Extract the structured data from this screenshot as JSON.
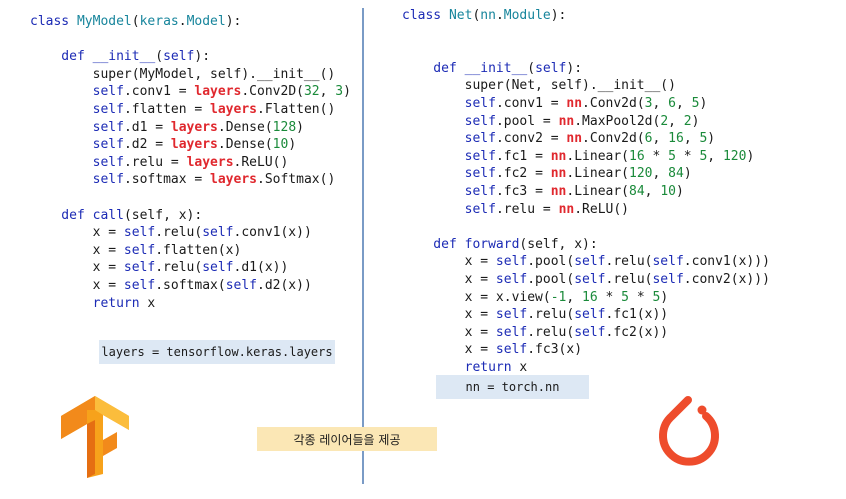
{
  "tensorflow": {
    "class_line": [
      {
        "t": "class ",
        "c": "kw"
      },
      {
        "t": "MyModel",
        "c": "cls"
      },
      {
        "t": "(",
        "c": "fg"
      },
      {
        "t": "keras",
        "c": "cls"
      },
      {
        "t": ".",
        "c": "fg"
      },
      {
        "t": "Model",
        "c": "cls"
      },
      {
        "t": "):",
        "c": "fg"
      }
    ],
    "lines": [
      [],
      [
        {
          "t": "    def ",
          "c": "kw"
        },
        {
          "t": "__init__",
          "c": "fn"
        },
        {
          "t": "(",
          "c": "fg"
        },
        {
          "t": "self",
          "c": "kw"
        },
        {
          "t": "):",
          "c": "fg"
        }
      ],
      [
        {
          "t": "        super(MyModel, self).__init__()",
          "c": "fg"
        }
      ],
      [
        {
          "t": "        ",
          "c": "fg"
        },
        {
          "t": "self",
          "c": "kw"
        },
        {
          "t": ".conv1 = ",
          "c": "fg"
        },
        {
          "t": "layers",
          "c": "lib"
        },
        {
          "t": ".Conv2D(",
          "c": "fg"
        },
        {
          "t": "32",
          "c": "num"
        },
        {
          "t": ", ",
          "c": "fg"
        },
        {
          "t": "3",
          "c": "num"
        },
        {
          "t": ")",
          "c": "fg"
        }
      ],
      [
        {
          "t": "        ",
          "c": "fg"
        },
        {
          "t": "self",
          "c": "kw"
        },
        {
          "t": ".flatten = ",
          "c": "fg"
        },
        {
          "t": "layers",
          "c": "lib"
        },
        {
          "t": ".Flatten()",
          "c": "fg"
        }
      ],
      [
        {
          "t": "        ",
          "c": "fg"
        },
        {
          "t": "self",
          "c": "kw"
        },
        {
          "t": ".d1 = ",
          "c": "fg"
        },
        {
          "t": "layers",
          "c": "lib"
        },
        {
          "t": ".Dense(",
          "c": "fg"
        },
        {
          "t": "128",
          "c": "num"
        },
        {
          "t": ")",
          "c": "fg"
        }
      ],
      [
        {
          "t": "        ",
          "c": "fg"
        },
        {
          "t": "self",
          "c": "kw"
        },
        {
          "t": ".d2 = ",
          "c": "fg"
        },
        {
          "t": "layers",
          "c": "lib"
        },
        {
          "t": ".Dense(",
          "c": "fg"
        },
        {
          "t": "10",
          "c": "num"
        },
        {
          "t": ")",
          "c": "fg"
        }
      ],
      [
        {
          "t": "        ",
          "c": "fg"
        },
        {
          "t": "self",
          "c": "kw"
        },
        {
          "t": ".relu = ",
          "c": "fg"
        },
        {
          "t": "layers",
          "c": "lib"
        },
        {
          "t": ".ReLU()",
          "c": "fg"
        }
      ],
      [
        {
          "t": "        ",
          "c": "fg"
        },
        {
          "t": "self",
          "c": "kw"
        },
        {
          "t": ".softmax = ",
          "c": "fg"
        },
        {
          "t": "layers",
          "c": "lib"
        },
        {
          "t": ".Softmax()",
          "c": "fg"
        }
      ],
      [],
      [
        {
          "t": "    def ",
          "c": "kw"
        },
        {
          "t": "call",
          "c": "fn"
        },
        {
          "t": "(self, x):",
          "c": "fg"
        }
      ],
      [
        {
          "t": "        x = ",
          "c": "fg"
        },
        {
          "t": "self",
          "c": "kw"
        },
        {
          "t": ".relu(",
          "c": "fg"
        },
        {
          "t": "self",
          "c": "kw"
        },
        {
          "t": ".conv1(x))",
          "c": "fg"
        }
      ],
      [
        {
          "t": "        x = ",
          "c": "fg"
        },
        {
          "t": "self",
          "c": "kw"
        },
        {
          "t": ".flatten(x)",
          "c": "fg"
        }
      ],
      [
        {
          "t": "        x = ",
          "c": "fg"
        },
        {
          "t": "self",
          "c": "kw"
        },
        {
          "t": ".relu(",
          "c": "fg"
        },
        {
          "t": "self",
          "c": "kw"
        },
        {
          "t": ".d1(x))",
          "c": "fg"
        }
      ],
      [
        {
          "t": "        x = ",
          "c": "fg"
        },
        {
          "t": "self",
          "c": "kw"
        },
        {
          "t": ".softmax(",
          "c": "fg"
        },
        {
          "t": "self",
          "c": "kw"
        },
        {
          "t": ".d2(x))",
          "c": "fg"
        }
      ],
      [
        {
          "t": "        ",
          "c": "fg"
        },
        {
          "t": "return",
          "c": "kw"
        },
        {
          "t": " x",
          "c": "fg"
        }
      ]
    ],
    "note": "layers = tensorflow.keras.layers"
  },
  "pytorch": {
    "class_line": [
      {
        "t": "class ",
        "c": "kw"
      },
      {
        "t": "Net",
        "c": "cls"
      },
      {
        "t": "(",
        "c": "fg"
      },
      {
        "t": "nn",
        "c": "cls"
      },
      {
        "t": ".",
        "c": "fg"
      },
      {
        "t": "Module",
        "c": "cls"
      },
      {
        "t": "):",
        "c": "fg"
      }
    ],
    "lines": [
      [],
      [],
      [
        {
          "t": "    def ",
          "c": "kw"
        },
        {
          "t": "__init__",
          "c": "fn"
        },
        {
          "t": "(",
          "c": "fg"
        },
        {
          "t": "self",
          "c": "kw"
        },
        {
          "t": "):",
          "c": "fg"
        }
      ],
      [
        {
          "t": "        super(Net, self).__init__()",
          "c": "fg"
        }
      ],
      [
        {
          "t": "        ",
          "c": "fg"
        },
        {
          "t": "self",
          "c": "kw"
        },
        {
          "t": ".conv1 = ",
          "c": "fg"
        },
        {
          "t": "nn",
          "c": "lib"
        },
        {
          "t": ".Conv2d(",
          "c": "fg"
        },
        {
          "t": "3",
          "c": "num"
        },
        {
          "t": ", ",
          "c": "fg"
        },
        {
          "t": "6",
          "c": "num"
        },
        {
          "t": ", ",
          "c": "fg"
        },
        {
          "t": "5",
          "c": "num"
        },
        {
          "t": ")",
          "c": "fg"
        }
      ],
      [
        {
          "t": "        ",
          "c": "fg"
        },
        {
          "t": "self",
          "c": "kw"
        },
        {
          "t": ".pool = ",
          "c": "fg"
        },
        {
          "t": "nn",
          "c": "lib"
        },
        {
          "t": ".MaxPool2d(",
          "c": "fg"
        },
        {
          "t": "2",
          "c": "num"
        },
        {
          "t": ", ",
          "c": "fg"
        },
        {
          "t": "2",
          "c": "num"
        },
        {
          "t": ")",
          "c": "fg"
        }
      ],
      [
        {
          "t": "        ",
          "c": "fg"
        },
        {
          "t": "self",
          "c": "kw"
        },
        {
          "t": ".conv2 = ",
          "c": "fg"
        },
        {
          "t": "nn",
          "c": "lib"
        },
        {
          "t": ".Conv2d(",
          "c": "fg"
        },
        {
          "t": "6",
          "c": "num"
        },
        {
          "t": ", ",
          "c": "fg"
        },
        {
          "t": "16",
          "c": "num"
        },
        {
          "t": ", ",
          "c": "fg"
        },
        {
          "t": "5",
          "c": "num"
        },
        {
          "t": ")",
          "c": "fg"
        }
      ],
      [
        {
          "t": "        ",
          "c": "fg"
        },
        {
          "t": "self",
          "c": "kw"
        },
        {
          "t": ".fc1 = ",
          "c": "fg"
        },
        {
          "t": "nn",
          "c": "lib"
        },
        {
          "t": ".Linear(",
          "c": "fg"
        },
        {
          "t": "16",
          "c": "num"
        },
        {
          "t": " * ",
          "c": "fg"
        },
        {
          "t": "5",
          "c": "num"
        },
        {
          "t": " * ",
          "c": "fg"
        },
        {
          "t": "5",
          "c": "num"
        },
        {
          "t": ", ",
          "c": "fg"
        },
        {
          "t": "120",
          "c": "num"
        },
        {
          "t": ")",
          "c": "fg"
        }
      ],
      [
        {
          "t": "        ",
          "c": "fg"
        },
        {
          "t": "self",
          "c": "kw"
        },
        {
          "t": ".fc2 = ",
          "c": "fg"
        },
        {
          "t": "nn",
          "c": "lib"
        },
        {
          "t": ".Linear(",
          "c": "fg"
        },
        {
          "t": "120",
          "c": "num"
        },
        {
          "t": ", ",
          "c": "fg"
        },
        {
          "t": "84",
          "c": "num"
        },
        {
          "t": ")",
          "c": "fg"
        }
      ],
      [
        {
          "t": "        ",
          "c": "fg"
        },
        {
          "t": "self",
          "c": "kw"
        },
        {
          "t": ".fc3 = ",
          "c": "fg"
        },
        {
          "t": "nn",
          "c": "lib"
        },
        {
          "t": ".Linear(",
          "c": "fg"
        },
        {
          "t": "84",
          "c": "num"
        },
        {
          "t": ", ",
          "c": "fg"
        },
        {
          "t": "10",
          "c": "num"
        },
        {
          "t": ")",
          "c": "fg"
        }
      ],
      [
        {
          "t": "        ",
          "c": "fg"
        },
        {
          "t": "self",
          "c": "kw"
        },
        {
          "t": ".relu = ",
          "c": "fg"
        },
        {
          "t": "nn",
          "c": "lib"
        },
        {
          "t": ".ReLU()",
          "c": "fg"
        }
      ],
      [],
      [
        {
          "t": "    def ",
          "c": "kw"
        },
        {
          "t": "forward",
          "c": "fn"
        },
        {
          "t": "(self, x):",
          "c": "fg"
        }
      ],
      [
        {
          "t": "        x = ",
          "c": "fg"
        },
        {
          "t": "self",
          "c": "kw"
        },
        {
          "t": ".pool(",
          "c": "fg"
        },
        {
          "t": "self",
          "c": "kw"
        },
        {
          "t": ".relu(",
          "c": "fg"
        },
        {
          "t": "self",
          "c": "kw"
        },
        {
          "t": ".conv1(x)))",
          "c": "fg"
        }
      ],
      [
        {
          "t": "        x = ",
          "c": "fg"
        },
        {
          "t": "self",
          "c": "kw"
        },
        {
          "t": ".pool(",
          "c": "fg"
        },
        {
          "t": "self",
          "c": "kw"
        },
        {
          "t": ".relu(",
          "c": "fg"
        },
        {
          "t": "self",
          "c": "kw"
        },
        {
          "t": ".conv2(x)))",
          "c": "fg"
        }
      ],
      [
        {
          "t": "        x = x.view(",
          "c": "fg"
        },
        {
          "t": "-1",
          "c": "num"
        },
        {
          "t": ", ",
          "c": "fg"
        },
        {
          "t": "16",
          "c": "num"
        },
        {
          "t": " * ",
          "c": "fg"
        },
        {
          "t": "5",
          "c": "num"
        },
        {
          "t": " * ",
          "c": "fg"
        },
        {
          "t": "5",
          "c": "num"
        },
        {
          "t": ")",
          "c": "fg"
        }
      ],
      [
        {
          "t": "        x = ",
          "c": "fg"
        },
        {
          "t": "self",
          "c": "kw"
        },
        {
          "t": ".relu(",
          "c": "fg"
        },
        {
          "t": "self",
          "c": "kw"
        },
        {
          "t": ".fc1(x))",
          "c": "fg"
        }
      ],
      [
        {
          "t": "        x = ",
          "c": "fg"
        },
        {
          "t": "self",
          "c": "kw"
        },
        {
          "t": ".relu(",
          "c": "fg"
        },
        {
          "t": "self",
          "c": "kw"
        },
        {
          "t": ".fc2(x))",
          "c": "fg"
        }
      ],
      [
        {
          "t": "        x = ",
          "c": "fg"
        },
        {
          "t": "self",
          "c": "kw"
        },
        {
          "t": ".fc3(x)",
          "c": "fg"
        }
      ],
      [
        {
          "t": "        ",
          "c": "fg"
        },
        {
          "t": "return",
          "c": "kw"
        },
        {
          "t": " x",
          "c": "fg"
        }
      ]
    ],
    "note": "nn = torch.nn"
  },
  "center_note": "각종 레이어들을 제공",
  "icons": {
    "tensorflow": "tensorflow-logo-icon",
    "pytorch": "pytorch-logo-icon"
  },
  "colors": {
    "keyword": "#1c2bb5",
    "class_name": "#17859c",
    "library": "#e0282e",
    "number": "#1a8a3a",
    "tensorflow_orange": "#f28a1b",
    "pytorch_red": "#ee4c2c",
    "note_blue": "#dde8f4",
    "note_yellow": "#fbe7b5",
    "divider": "#7a9bc6"
  }
}
